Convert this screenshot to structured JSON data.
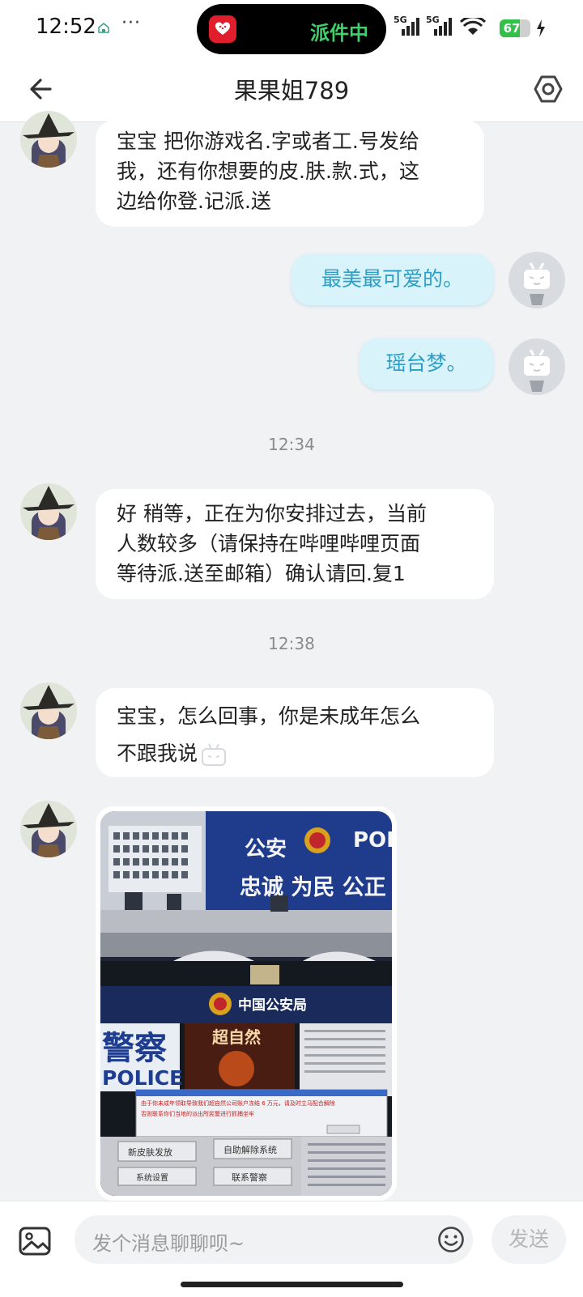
{
  "status": {
    "time": "12:52",
    "dots": "···",
    "island_text": "派件中",
    "net1": "5G",
    "net2": "5G",
    "battery": "67",
    "battery_level": 0.67
  },
  "header": {
    "title": "果果姐789"
  },
  "messages": {
    "m1": [
      "宝宝 把你游戏名.字或者工.号发给",
      "我，还有你想要的皮.肤.款.式，这",
      "边给你登.记派.送"
    ],
    "m2": "最美最可爱的。",
    "m3": "瑶台梦。",
    "t1": "12:34",
    "m4": [
      "好 稍等，正在为你安排过去，当前",
      "人数较多（请保持在哔哩哔哩页面",
      "等待派.送至邮箱）确认请回.复1"
    ],
    "t2": "12:38",
    "m5": [
      "宝宝，怎么回事，你是未成年怎么",
      "不跟我说"
    ]
  },
  "photo": {
    "sign1": "公安",
    "sign2": "POL",
    "sign3": "忠诚 为民 公正",
    "bureau": "中国公安局",
    "police_cn": "警察",
    "police_en": "POLICE",
    "game": "超自然",
    "notice": [
      "由于你未成年领取导致我们超自然公司账户冻结 6 万元，请及时立马配合解除",
      "否则联系你们当地的派出所民警进行抓捕坐牢"
    ],
    "btn1": "新皮肤发放",
    "btn2": "自助解除系统",
    "btn3": "系统设置",
    "btn4": "联系警察"
  },
  "input": {
    "placeholder": "发个消息聊聊呗~",
    "send": "发送"
  }
}
